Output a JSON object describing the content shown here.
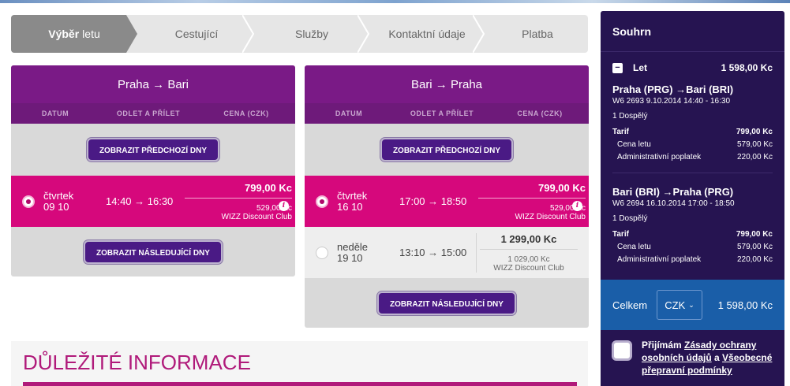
{
  "steps": [
    "Výběr",
    "letu",
    "Cestující",
    "Služby",
    "Kontaktní údaje",
    "Platba"
  ],
  "columns": {
    "date": "DATUM",
    "times": "ODLET A PŘÍLET",
    "price": "CENA (CZK)"
  },
  "outbound": {
    "title": "Praha → Bari",
    "prev_button": "ZOBRAZIT PŘEDCHOZÍ DNY",
    "next_button": "ZOBRAZIT NÁSLEDUJÍCÍ DNY",
    "rows": [
      {
        "day": "čtvrtek",
        "date": "09 10",
        "times": "14:40 → 16:30",
        "price": "799,00 Kc",
        "club_price": "529,00 Kc",
        "club": "WIZZ Discount Club",
        "selected": true
      }
    ]
  },
  "inbound": {
    "title": "Bari → Praha",
    "prev_button": "ZOBRAZIT PŘEDCHOZÍ DNY",
    "next_button": "ZOBRAZIT NÁSLEDUJÍCÍ DNY",
    "rows": [
      {
        "day": "čtvrtek",
        "date": "16 10",
        "times": "17:00 → 18:50",
        "price": "799,00 Kc",
        "club_price": "529,00 Kc",
        "club": "WIZZ Discount Club",
        "selected": true
      },
      {
        "day": "neděle",
        "date": "19 10",
        "times": "13:10 → 15:00",
        "price": "1 299,00 Kc",
        "club_price": "1 029,00 Kc",
        "club": "WIZZ Discount Club",
        "selected": false
      }
    ]
  },
  "important": {
    "title": "DŮLEŽITÉ INFORMACE"
  },
  "summary": {
    "title": "Souhrn",
    "flight_label": "Let",
    "flight_total": "1 598,00 Kc",
    "segments": [
      {
        "route": "Praha (PRG) →Bari (BRI)",
        "meta": "W6 2693  9.10.2014 14:40 - 16:30",
        "pax": "1 Dospělý",
        "tarif_label": "Tarif",
        "tarif": "799,00 Kc",
        "fare_label": "Cena letu",
        "fare": "579,00 Kc",
        "fee_label": "Administrativní poplatek",
        "fee": "220,00 Kc"
      },
      {
        "route": "Bari (BRI) →Praha (PRG)",
        "meta": "W6 2694  16.10.2014 17:00 - 18:50",
        "pax": "1 Dospělý",
        "tarif_label": "Tarif",
        "tarif": "799,00 Kc",
        "fare_label": "Cena letu",
        "fare": "579,00 Kc",
        "fee_label": "Administrativní poplatek",
        "fee": "220,00 Kc"
      }
    ],
    "total_label": "Celkem",
    "currency": "CZK",
    "total": "1 598,00 Kc",
    "accept_prefix": "Přijímám",
    "accept_link1": "Zásady ochrany osobních údajů",
    "accept_mid": "a",
    "accept_link2": "Všeobecné přepravní podmínky"
  },
  "colors": {
    "purple_header": "#7a1a86",
    "magenta": "#d6087c",
    "button": "#4a1a85",
    "summary_bg": "#261451",
    "total_bg": "#1a5ea8",
    "important": "#b01a7a"
  },
  "icons": {
    "info": "info-icon",
    "radio": "radio-icon",
    "checkbox": "checkbox-icon",
    "chevron": "chevron-down-icon",
    "minus": "minus-icon"
  }
}
